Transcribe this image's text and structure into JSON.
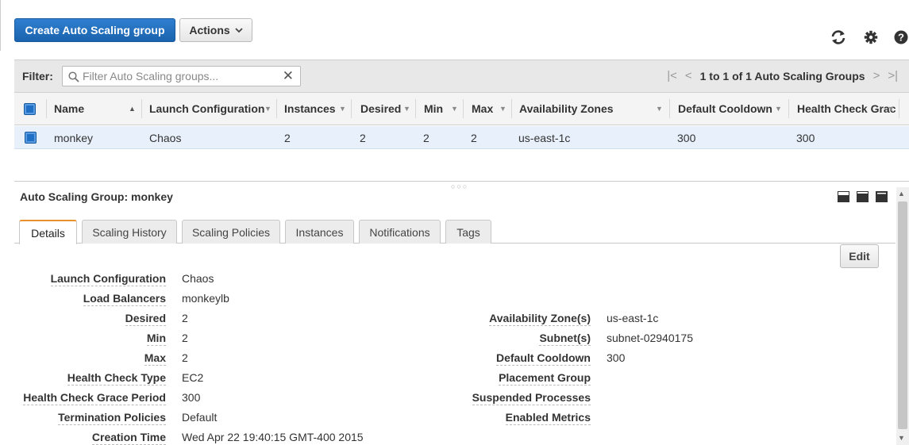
{
  "toolbar": {
    "create_label": "Create Auto Scaling group",
    "actions_label": "Actions",
    "icons": [
      "refresh-icon",
      "gear-icon",
      "help-icon"
    ]
  },
  "filter": {
    "label": "Filter:",
    "placeholder": "Filter Auto Scaling groups...",
    "pagination": "1 to 1 of 1 Auto Scaling Groups"
  },
  "table": {
    "headers": {
      "name": "Name",
      "launch_configuration": "Launch Configuration",
      "instances": "Instances",
      "desired": "Desired",
      "min": "Min",
      "max": "Max",
      "availability_zones": "Availability Zones",
      "default_cooldown": "Default Cooldown",
      "health_check_grace": "Health Check Grac"
    },
    "rows": [
      {
        "name": "monkey",
        "launch_configuration": "Chaos",
        "instances": "2",
        "desired": "2",
        "min": "2",
        "max": "2",
        "availability_zones": "us-east-1c",
        "default_cooldown": "300",
        "health_check_grace": "300"
      }
    ]
  },
  "detail": {
    "title": "Auto Scaling Group: monkey",
    "tabs": [
      "Details",
      "Scaling History",
      "Scaling Policies",
      "Instances",
      "Notifications",
      "Tags"
    ],
    "active_tab": "Details",
    "edit_label": "Edit",
    "left_fields": [
      {
        "label": "Launch Configuration",
        "value": "Chaos"
      },
      {
        "label": "Load Balancers",
        "value": "monkeylb"
      },
      {
        "label": "Desired",
        "value": "2"
      },
      {
        "label": "Min",
        "value": "2"
      },
      {
        "label": "Max",
        "value": "2"
      },
      {
        "label": "Health Check Type",
        "value": "EC2"
      },
      {
        "label": "Health Check Grace Period",
        "value": "300"
      },
      {
        "label": "Termination Policies",
        "value": "Default"
      },
      {
        "label": "Creation Time",
        "value": "Wed Apr 22 19:40:15 GMT-400 2015"
      }
    ],
    "right_fields": [
      {
        "label": "Availability Zone(s)",
        "value": "us-east-1c"
      },
      {
        "label": "Subnet(s)",
        "value": "subnet-02940175"
      },
      {
        "label": "Default Cooldown",
        "value": "300"
      },
      {
        "label": "Placement Group",
        "value": ""
      },
      {
        "label": "Suspended Processes",
        "value": ""
      },
      {
        "label": "Enabled Metrics",
        "value": ""
      }
    ]
  },
  "colors": {
    "primary": "#1f6fc4",
    "row_selected": "#e7f0fb",
    "active_tab_accent": "#e8912d"
  }
}
